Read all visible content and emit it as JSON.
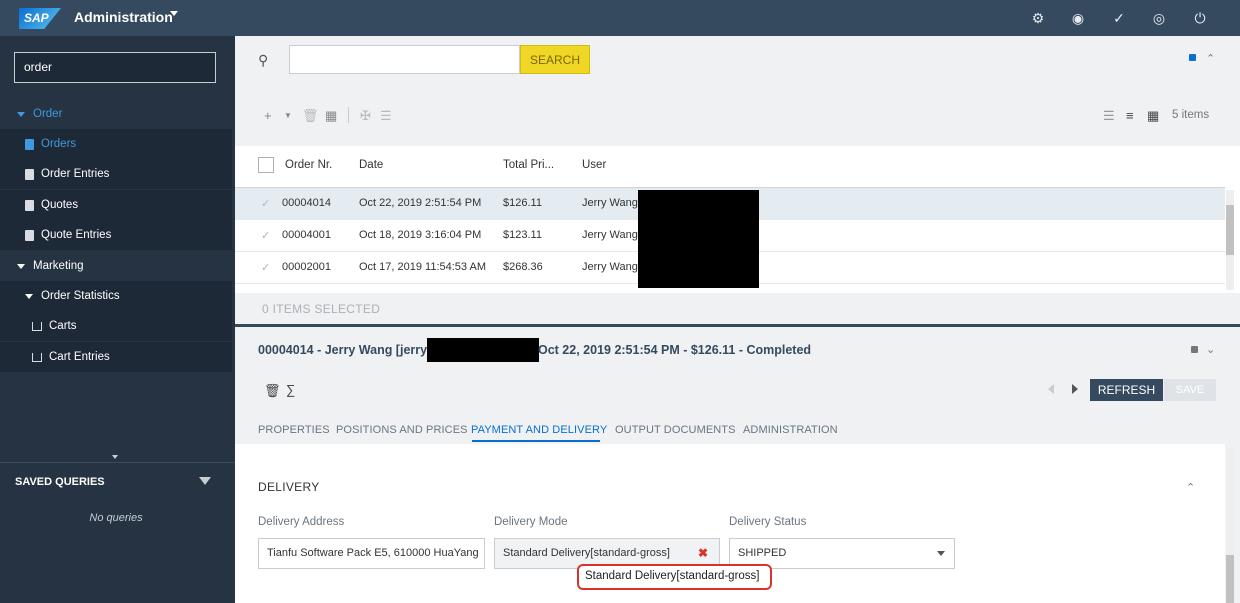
{
  "topbar": {
    "logo": "SAP",
    "title": "Administration",
    "icons": [
      "user-settings-icon",
      "globe-icon",
      "checklist-icon",
      "world-icon",
      "power-icon"
    ]
  },
  "sidebar": {
    "search_value": "order",
    "items": [
      {
        "label": "Order"
      },
      {
        "label": "Orders"
      },
      {
        "label": "Order Entries"
      },
      {
        "label": "Quotes"
      },
      {
        "label": "Quote Entries"
      },
      {
        "label": "Marketing"
      },
      {
        "label": "Order Statistics"
      },
      {
        "label": "Carts"
      },
      {
        "label": "Cart Entries"
      }
    ],
    "saved_queries_title": "SAVED QUERIES",
    "no_queries": "No queries"
  },
  "search": {
    "button_label": "SEARCH",
    "value": ""
  },
  "list": {
    "items_count": "5 items",
    "columns": [
      "Order Nr.",
      "Date",
      "Total Pri...",
      "User"
    ],
    "rows": [
      {
        "order": "00004014",
        "date": "Oct 22, 2019 2:51:54 PM",
        "total": "$126.11",
        "user": "Jerry Wang"
      },
      {
        "order": "00004001",
        "date": "Oct 18, 2019 3:16:04 PM",
        "total": "$123.11",
        "user": "Jerry Wang"
      },
      {
        "order": "00002001",
        "date": "Oct 17, 2019 11:54:53 AM",
        "total": "$268.36",
        "user": "Jerry Wang"
      }
    ],
    "selected_text": "0 ITEMS SELECTED"
  },
  "detail": {
    "title_prefix": "00004014 - Jerry Wang [jerry",
    "title_suffix": "Oct 22, 2019 2:51:54 PM - $126.11 - Completed",
    "refresh_label": "REFRESH",
    "save_label": "SAVE",
    "tabs": [
      "PROPERTIES",
      "POSITIONS AND PRICES",
      "PAYMENT AND DELIVERY",
      "OUTPUT DOCUMENTS",
      "ADMINISTRATION"
    ],
    "active_tab": "PAYMENT AND DELIVERY",
    "section_title": "DELIVERY",
    "fields": {
      "address_label": "Delivery Address",
      "address_value": "Tianfu Software Pack E5, 610000 HuaYang",
      "mode_label": "Delivery Mode",
      "mode_value": "Standard Delivery[standard-gross]",
      "status_label": "Delivery Status",
      "status_value": "SHIPPED"
    },
    "tooltip": "Standard Delivery[standard-gross]"
  },
  "colors": {
    "topbar": "#354a5f",
    "sidebar": "#253342",
    "accent": "#0a6ed1",
    "search_button": "#f0d625",
    "tooltip_border": "#d9342b"
  }
}
